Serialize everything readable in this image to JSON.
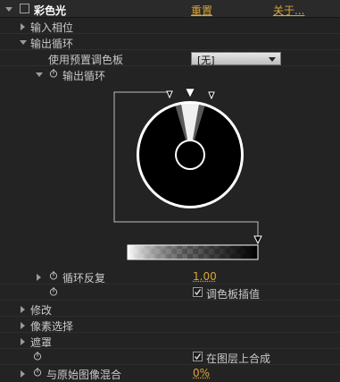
{
  "effect": {
    "name": "彩色光",
    "reset_label": "重置",
    "about_label": "关于..."
  },
  "rows": {
    "input_phase": "输入相位",
    "output_cycle": "输出循环",
    "use_preset_palette": "使用预置调色板",
    "preset_value": "[无]",
    "output_cycle_graph": "输出循环",
    "cycle_repeat": "循环反复",
    "cycle_repeat_value": "1.00",
    "interpolate_palette": "调色板插值",
    "modify": "修改",
    "pixel_select": "像素选择",
    "mask": "遮罩",
    "composite_on_layer": "在图层上合成",
    "blend_with_original": "与原始图像混合",
    "blend_value": "0%"
  },
  "checks": {
    "interpolate_palette": true,
    "composite_on_layer": true
  },
  "colors": {
    "accent": "#d9a43c",
    "background": "#232323"
  }
}
